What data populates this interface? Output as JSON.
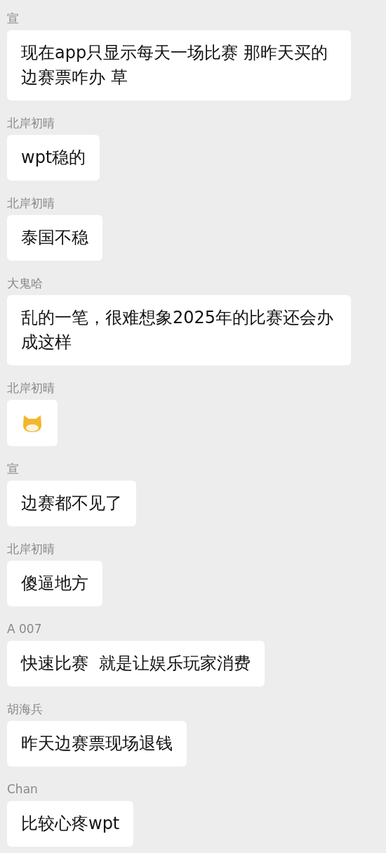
{
  "messages": [
    {
      "sender": "宣",
      "kind": "text",
      "text": "现在app只显示每天一场比赛 那昨天买的边赛票咋办 草"
    },
    {
      "sender": "北岸初晴",
      "kind": "text",
      "text": "wpt稳的"
    },
    {
      "sender": "北岸初晴",
      "kind": "text",
      "text": "泰国不稳"
    },
    {
      "sender": "大鬼哈",
      "kind": "text",
      "text": "乱的一笔，很难想象2025年的比赛还会办成这样"
    },
    {
      "sender": "北岸初晴",
      "kind": "sticker"
    },
    {
      "sender": "宣",
      "kind": "text",
      "text": "边赛都不见了"
    },
    {
      "sender": "北岸初晴",
      "kind": "text",
      "text": "傻逼地方"
    },
    {
      "sender": "A 007",
      "kind": "text",
      "text": "快速比赛  就是让娱乐玩家消费"
    },
    {
      "sender": "胡海兵",
      "kind": "text",
      "text": "昨天边赛票现场退钱"
    },
    {
      "sender": "Chan",
      "kind": "text",
      "text": "比较心疼wpt"
    }
  ]
}
